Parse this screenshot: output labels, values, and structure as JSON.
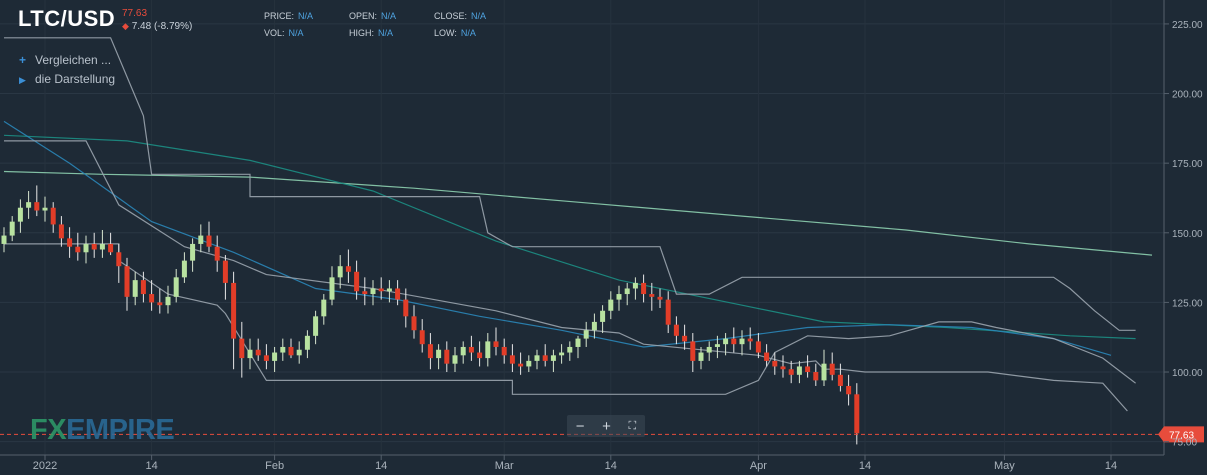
{
  "header": {
    "symbol": "LTC/USD",
    "last_price": "77.63",
    "change": "7.48 (-8.79%)"
  },
  "stats": [
    {
      "label": "PRICE:",
      "value": "N/A"
    },
    {
      "label": "VOL:",
      "value": "N/A"
    },
    {
      "label": "OPEN:",
      "value": "N/A"
    },
    {
      "label": "HIGH:",
      "value": "N/A"
    },
    {
      "label": "CLOSE:",
      "value": "N/A"
    },
    {
      "label": "LOW:",
      "value": "N/A"
    }
  ],
  "links": {
    "compare": "Vergleichen ...",
    "display": "die Darstellung"
  },
  "logo": {
    "fx": "FX",
    "empire": "EMPIRE"
  },
  "colors": {
    "background": "#1e2a36",
    "up": "#b8e2a0",
    "down": "#e23d28",
    "ma_blue": "#2a86b8",
    "ma_teal": "#1c8e84",
    "ma_green": "#8dd0b0",
    "donchian": "#9aa4ae",
    "price_marker": "#e74c3c"
  },
  "chart_data": {
    "type": "candlestick",
    "title": "LTC/USD",
    "y_axis": {
      "side": "right",
      "ticks": [
        75,
        100,
        125,
        150,
        175,
        200,
        225
      ],
      "ylim": [
        72,
        230
      ]
    },
    "x_axis": {
      "ticks": [
        {
          "label": "2022",
          "index": 5
        },
        {
          "label": "14",
          "index": 18
        },
        {
          "label": "Feb",
          "index": 33
        },
        {
          "label": "14",
          "index": 46
        },
        {
          "label": "Mar",
          "index": 61
        },
        {
          "label": "14",
          "index": 74
        },
        {
          "label": "Apr",
          "index": 92
        },
        {
          "label": "14",
          "index": 105
        },
        {
          "label": "May",
          "index": 122
        },
        {
          "label": "14",
          "index": 135
        }
      ]
    },
    "current_price": 77.63,
    "current_price_label": "77.63",
    "candles": [
      {
        "o": 146,
        "h": 152,
        "l": 143,
        "c": 149
      },
      {
        "o": 149,
        "h": 156,
        "l": 147,
        "c": 154
      },
      {
        "o": 154,
        "h": 162,
        "l": 150,
        "c": 159
      },
      {
        "o": 159,
        "h": 165,
        "l": 155,
        "c": 161
      },
      {
        "o": 161,
        "h": 167,
        "l": 156,
        "c": 158
      },
      {
        "o": 158,
        "h": 163,
        "l": 154,
        "c": 159
      },
      {
        "o": 159,
        "h": 161,
        "l": 150,
        "c": 153
      },
      {
        "o": 153,
        "h": 156,
        "l": 145,
        "c": 148
      },
      {
        "o": 148,
        "h": 152,
        "l": 141,
        "c": 145
      },
      {
        "o": 145,
        "h": 150,
        "l": 140,
        "c": 143
      },
      {
        "o": 143,
        "h": 149,
        "l": 139,
        "c": 146
      },
      {
        "o": 146,
        "h": 150,
        "l": 141,
        "c": 144
      },
      {
        "o": 144,
        "h": 151,
        "l": 141,
        "c": 146
      },
      {
        "o": 146,
        "h": 150,
        "l": 142,
        "c": 143
      },
      {
        "o": 143,
        "h": 146,
        "l": 132,
        "c": 138
      },
      {
        "o": 138,
        "h": 141,
        "l": 122,
        "c": 127
      },
      {
        "o": 127,
        "h": 136,
        "l": 124,
        "c": 133
      },
      {
        "o": 133,
        "h": 136,
        "l": 125,
        "c": 128
      },
      {
        "o": 128,
        "h": 133,
        "l": 122,
        "c": 125
      },
      {
        "o": 125,
        "h": 130,
        "l": 121,
        "c": 124
      },
      {
        "o": 124,
        "h": 131,
        "l": 121,
        "c": 127
      },
      {
        "o": 127,
        "h": 137,
        "l": 125,
        "c": 134
      },
      {
        "o": 134,
        "h": 143,
        "l": 132,
        "c": 140
      },
      {
        "o": 140,
        "h": 148,
        "l": 136,
        "c": 146
      },
      {
        "o": 146,
        "h": 153,
        "l": 143,
        "c": 149
      },
      {
        "o": 149,
        "h": 154,
        "l": 143,
        "c": 145
      },
      {
        "o": 145,
        "h": 149,
        "l": 136,
        "c": 140
      },
      {
        "o": 140,
        "h": 142,
        "l": 126,
        "c": 132
      },
      {
        "o": 132,
        "h": 136,
        "l": 101,
        "c": 112
      },
      {
        "o": 112,
        "h": 118,
        "l": 98,
        "c": 105
      },
      {
        "o": 105,
        "h": 112,
        "l": 101,
        "c": 108
      },
      {
        "o": 108,
        "h": 112,
        "l": 104,
        "c": 106
      },
      {
        "o": 106,
        "h": 110,
        "l": 101,
        "c": 104
      },
      {
        "o": 104,
        "h": 109,
        "l": 100,
        "c": 107
      },
      {
        "o": 107,
        "h": 112,
        "l": 104,
        "c": 109
      },
      {
        "o": 109,
        "h": 112,
        "l": 105,
        "c": 106
      },
      {
        "o": 106,
        "h": 111,
        "l": 103,
        "c": 108
      },
      {
        "o": 108,
        "h": 115,
        "l": 105,
        "c": 113
      },
      {
        "o": 113,
        "h": 122,
        "l": 110,
        "c": 120
      },
      {
        "o": 120,
        "h": 128,
        "l": 117,
        "c": 126
      },
      {
        "o": 126,
        "h": 138,
        "l": 124,
        "c": 134
      },
      {
        "o": 134,
        "h": 142,
        "l": 130,
        "c": 138
      },
      {
        "o": 138,
        "h": 144,
        "l": 132,
        "c": 136
      },
      {
        "o": 136,
        "h": 140,
        "l": 126,
        "c": 129
      },
      {
        "o": 129,
        "h": 134,
        "l": 124,
        "c": 128
      },
      {
        "o": 128,
        "h": 133,
        "l": 124,
        "c": 130
      },
      {
        "o": 130,
        "h": 134,
        "l": 126,
        "c": 129
      },
      {
        "o": 129,
        "h": 133,
        "l": 125,
        "c": 130
      },
      {
        "o": 130,
        "h": 133,
        "l": 124,
        "c": 126
      },
      {
        "o": 126,
        "h": 130,
        "l": 116,
        "c": 120
      },
      {
        "o": 120,
        "h": 124,
        "l": 112,
        "c": 115
      },
      {
        "o": 115,
        "h": 119,
        "l": 107,
        "c": 110
      },
      {
        "o": 110,
        "h": 114,
        "l": 101,
        "c": 105
      },
      {
        "o": 105,
        "h": 110,
        "l": 101,
        "c": 108
      },
      {
        "o": 108,
        "h": 111,
        "l": 100,
        "c": 103
      },
      {
        "o": 103,
        "h": 109,
        "l": 100,
        "c": 106
      },
      {
        "o": 106,
        "h": 111,
        "l": 103,
        "c": 109
      },
      {
        "o": 109,
        "h": 113,
        "l": 104,
        "c": 107
      },
      {
        "o": 107,
        "h": 111,
        "l": 102,
        "c": 105
      },
      {
        "o": 105,
        "h": 114,
        "l": 102,
        "c": 111
      },
      {
        "o": 111,
        "h": 116,
        "l": 106,
        "c": 109
      },
      {
        "o": 109,
        "h": 112,
        "l": 103,
        "c": 106
      },
      {
        "o": 106,
        "h": 110,
        "l": 100,
        "c": 103
      },
      {
        "o": 103,
        "h": 107,
        "l": 99,
        "c": 102
      },
      {
        "o": 102,
        "h": 106,
        "l": 100,
        "c": 104
      },
      {
        "o": 104,
        "h": 108,
        "l": 101,
        "c": 106
      },
      {
        "o": 106,
        "h": 110,
        "l": 102,
        "c": 104
      },
      {
        "o": 104,
        "h": 108,
        "l": 100,
        "c": 106
      },
      {
        "o": 106,
        "h": 110,
        "l": 103,
        "c": 107
      },
      {
        "o": 107,
        "h": 111,
        "l": 104,
        "c": 109
      },
      {
        "o": 109,
        "h": 113,
        "l": 105,
        "c": 112
      },
      {
        "o": 112,
        "h": 118,
        "l": 109,
        "c": 115
      },
      {
        "o": 115,
        "h": 121,
        "l": 112,
        "c": 118
      },
      {
        "o": 118,
        "h": 124,
        "l": 114,
        "c": 122
      },
      {
        "o": 122,
        "h": 129,
        "l": 119,
        "c": 126
      },
      {
        "o": 126,
        "h": 131,
        "l": 122,
        "c": 128
      },
      {
        "o": 128,
        "h": 132,
        "l": 124,
        "c": 130
      },
      {
        "o": 130,
        "h": 134,
        "l": 126,
        "c": 132
      },
      {
        "o": 132,
        "h": 135,
        "l": 125,
        "c": 128
      },
      {
        "o": 128,
        "h": 132,
        "l": 122,
        "c": 127
      },
      {
        "o": 127,
        "h": 130,
        "l": 123,
        "c": 126
      },
      {
        "o": 126,
        "h": 129,
        "l": 114,
        "c": 117
      },
      {
        "o": 117,
        "h": 120,
        "l": 110,
        "c": 113
      },
      {
        "o": 113,
        "h": 117,
        "l": 108,
        "c": 111
      },
      {
        "o": 111,
        "h": 114,
        "l": 100,
        "c": 104
      },
      {
        "o": 104,
        "h": 109,
        "l": 101,
        "c": 107
      },
      {
        "o": 107,
        "h": 111,
        "l": 104,
        "c": 109
      },
      {
        "o": 109,
        "h": 113,
        "l": 105,
        "c": 110
      },
      {
        "o": 110,
        "h": 114,
        "l": 106,
        "c": 112
      },
      {
        "o": 112,
        "h": 116,
        "l": 107,
        "c": 110
      },
      {
        "o": 110,
        "h": 115,
        "l": 106,
        "c": 112
      },
      {
        "o": 112,
        "h": 116,
        "l": 108,
        "c": 111
      },
      {
        "o": 111,
        "h": 114,
        "l": 105,
        "c": 107
      },
      {
        "o": 107,
        "h": 110,
        "l": 102,
        "c": 104
      },
      {
        "o": 104,
        "h": 107,
        "l": 99,
        "c": 102
      },
      {
        "o": 102,
        "h": 106,
        "l": 98,
        "c": 101
      },
      {
        "o": 101,
        "h": 104,
        "l": 96,
        "c": 99
      },
      {
        "o": 99,
        "h": 104,
        "l": 96,
        "c": 102
      },
      {
        "o": 102,
        "h": 106,
        "l": 98,
        "c": 100
      },
      {
        "o": 100,
        "h": 103,
        "l": 95,
        "c": 97
      },
      {
        "o": 97,
        "h": 108,
        "l": 95,
        "c": 103
      },
      {
        "o": 103,
        "h": 107,
        "l": 97,
        "c": 99
      },
      {
        "o": 99,
        "h": 103,
        "l": 93,
        "c": 95
      },
      {
        "o": 95,
        "h": 99,
        "l": 88,
        "c": 92
      },
      {
        "o": 92,
        "h": 96,
        "l": 74,
        "c": 78
      }
    ],
    "series": [
      {
        "kind": "moving-average",
        "color": "#8dd0b0",
        "values": [
          [
            0,
            172
          ],
          [
            12,
            171
          ],
          [
            30,
            170
          ],
          [
            50,
            166
          ],
          [
            70,
            161
          ],
          [
            90,
            156
          ],
          [
            110,
            151
          ],
          [
            125,
            146
          ],
          [
            140,
            142
          ]
        ]
      },
      {
        "kind": "moving-average",
        "color": "#1c8e84",
        "values": [
          [
            0,
            185
          ],
          [
            15,
            183
          ],
          [
            30,
            176
          ],
          [
            45,
            165
          ],
          [
            60,
            147
          ],
          [
            75,
            133
          ],
          [
            90,
            124
          ],
          [
            100,
            118
          ],
          [
            115,
            116
          ],
          [
            130,
            113
          ],
          [
            138,
            112
          ]
        ]
      },
      {
        "kind": "moving-average",
        "color": "#2a86b8",
        "values": [
          [
            0,
            190
          ],
          [
            8,
            175
          ],
          [
            18,
            154
          ],
          [
            28,
            143
          ],
          [
            38,
            130
          ],
          [
            48,
            126
          ],
          [
            58,
            120
          ],
          [
            68,
            115
          ],
          [
            78,
            109
          ],
          [
            88,
            112
          ],
          [
            98,
            116
          ],
          [
            108,
            117
          ],
          [
            118,
            116
          ],
          [
            128,
            112
          ],
          [
            135,
            106
          ]
        ]
      },
      {
        "kind": "donchian-upper",
        "color": "#9aa4ae",
        "values": [
          [
            0,
            220
          ],
          [
            13,
            220
          ],
          [
            17,
            192
          ],
          [
            18,
            171
          ],
          [
            30,
            171
          ],
          [
            30,
            163
          ],
          [
            58,
            163
          ],
          [
            59,
            150
          ],
          [
            62,
            145
          ],
          [
            80,
            145
          ],
          [
            82,
            128
          ],
          [
            86,
            128
          ],
          [
            90,
            134
          ],
          [
            105,
            134
          ],
          [
            128,
            134
          ],
          [
            130,
            130
          ],
          [
            133,
            122
          ],
          [
            136,
            115
          ],
          [
            138,
            115
          ]
        ]
      },
      {
        "kind": "donchian-lower",
        "color": "#9aa4ae",
        "values": [
          [
            0,
            146
          ],
          [
            14,
            146
          ],
          [
            14,
            140
          ],
          [
            20,
            128
          ],
          [
            26,
            124
          ],
          [
            27,
            121
          ],
          [
            32,
            97
          ],
          [
            62,
            97
          ],
          [
            62,
            92
          ],
          [
            88,
            92
          ],
          [
            92,
            97
          ],
          [
            94,
            107
          ],
          [
            98,
            113
          ],
          [
            103,
            112
          ],
          [
            108,
            113
          ],
          [
            114,
            118
          ],
          [
            118,
            118
          ],
          [
            121,
            116
          ],
          [
            128,
            112
          ],
          [
            134,
            105
          ],
          [
            138,
            96
          ]
        ]
      },
      {
        "kind": "donchian-mid",
        "color": "#9aa4ae",
        "values": [
          [
            0,
            183
          ],
          [
            10,
            183
          ],
          [
            14,
            160
          ],
          [
            22,
            145
          ],
          [
            28,
            140
          ],
          [
            32,
            135
          ],
          [
            45,
            130
          ],
          [
            60,
            122
          ],
          [
            68,
            116
          ],
          [
            75,
            114
          ],
          [
            78,
            110
          ],
          [
            92,
            106
          ],
          [
            96,
            103
          ],
          [
            99,
            104
          ],
          [
            100,
            101
          ],
          [
            102,
            101
          ],
          [
            105,
            100
          ],
          [
            116,
            100
          ],
          [
            120,
            100
          ],
          [
            128,
            97
          ],
          [
            134,
            96
          ],
          [
            137,
            86
          ]
        ]
      }
    ]
  }
}
